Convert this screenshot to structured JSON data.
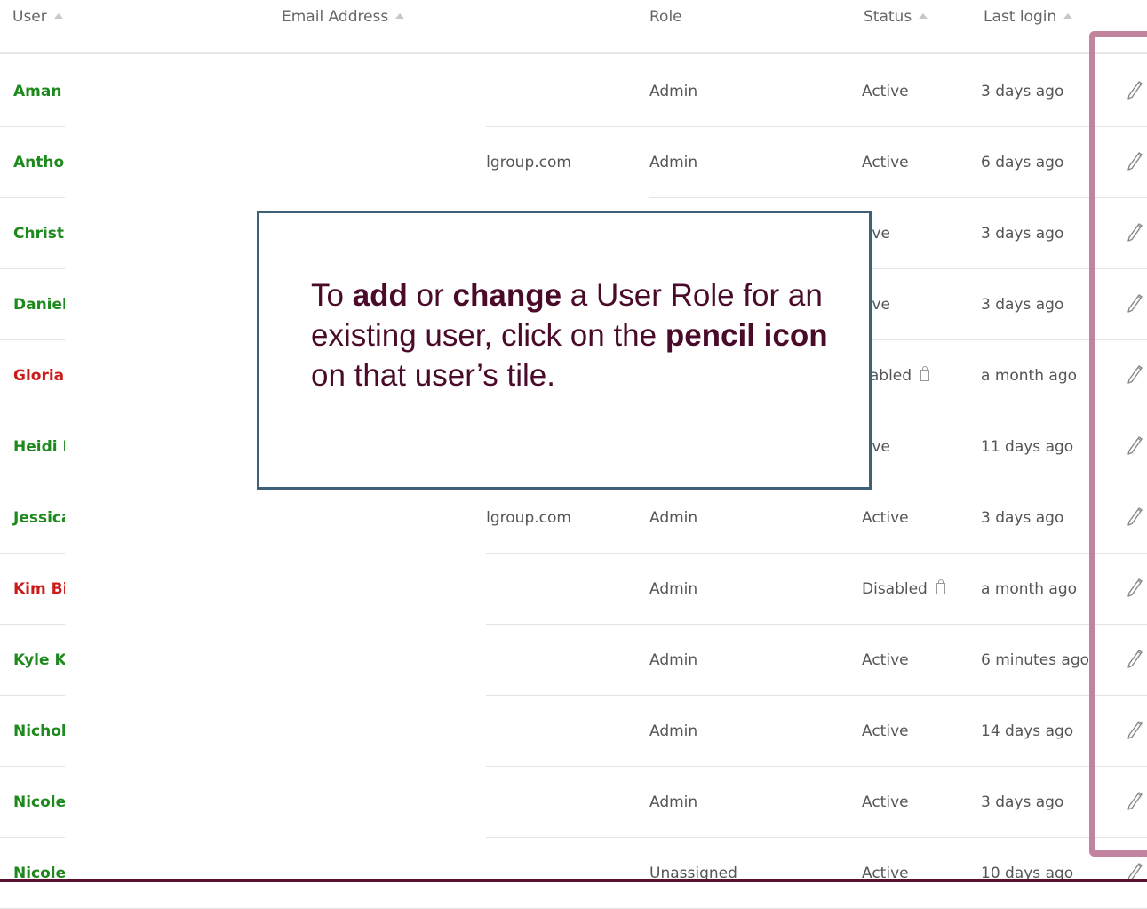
{
  "header": {
    "user": "User",
    "email": "Email Address",
    "role": "Role",
    "status": "Status",
    "last_login": "Last login"
  },
  "rows": [
    {
      "user": "Aman",
      "email": "",
      "role": "Admin",
      "status": "Active",
      "login": "3 days ago",
      "disabled": false
    },
    {
      "user": "Antho",
      "email": "ialgroup.com",
      "role": "Admin",
      "status": "Active",
      "login": "6 days ago",
      "disabled": false
    },
    {
      "user": "Christ",
      "email": "",
      "role": "",
      "status": "tive",
      "login": "3 days ago",
      "disabled": false
    },
    {
      "user": "Daniel",
      "email": "",
      "role": "",
      "status": "tive",
      "login": "3 days ago",
      "disabled": false
    },
    {
      "user": "Gloria",
      "email": "",
      "role": "",
      "status": "sabled",
      "login": "a month ago",
      "disabled": true
    },
    {
      "user": "Heidi I",
      "email": "",
      "role": "",
      "status": "tive",
      "login": "11 days ago",
      "disabled": false
    },
    {
      "user": "Jessica",
      "email": "ialgroup.com",
      "role": "Admin",
      "status": "Active",
      "login": "3 days ago",
      "disabled": false
    },
    {
      "user": "Kim Bi",
      "email": "",
      "role": "Admin",
      "status": "Disabled",
      "login": "a month ago",
      "disabled": true
    },
    {
      "user": "Kyle K",
      "email": "",
      "role": "Admin",
      "status": "Active",
      "login": "6 minutes ago",
      "disabled": false
    },
    {
      "user": "Nichol",
      "email": "",
      "role": "Admin",
      "status": "Active",
      "login": "14 days ago",
      "disabled": false
    },
    {
      "user": "Nicole",
      "email": "",
      "role": "Admin",
      "status": "Active",
      "login": "3 days ago",
      "disabled": false
    },
    {
      "user": "Nicole",
      "email": "",
      "role": "Unassigned",
      "status": "Active",
      "login": "10 days ago",
      "disabled": false
    }
  ],
  "callout": {
    "p1": "To ",
    "b1": "add",
    "p2": " or ",
    "b2": "change",
    "p3": " a User Role for an existing user, click on the ",
    "b3": "pencil icon",
    "p4": " on that user’s tile."
  },
  "colors": {
    "active_user": "#1e8a1e",
    "disabled_user": "#cc1b1b",
    "highlight": "#c2839f",
    "callout_border": "#3e6078",
    "callout_text": "#4a0a2a"
  }
}
